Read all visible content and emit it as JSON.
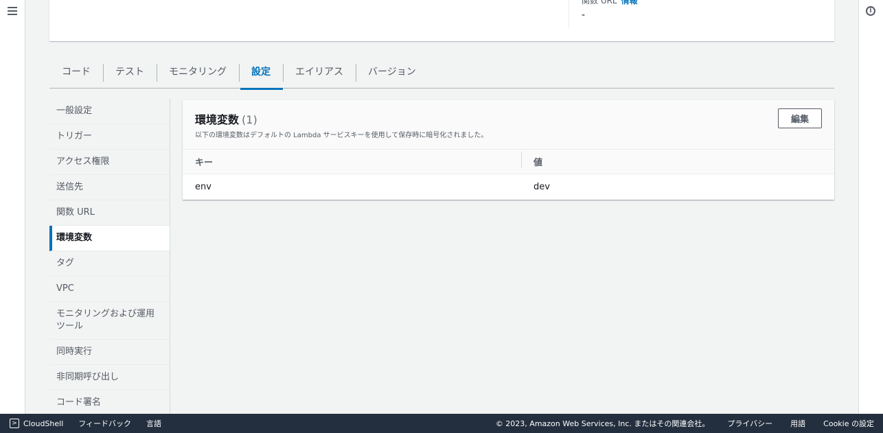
{
  "top": {
    "func_url_label": "関数 URL",
    "func_url_info": "情報",
    "func_url_value": "-"
  },
  "tabs": [
    {
      "label": "コード"
    },
    {
      "label": "テスト"
    },
    {
      "label": "モニタリング"
    },
    {
      "label": "設定",
      "active": true
    },
    {
      "label": "エイリアス"
    },
    {
      "label": "バージョン"
    }
  ],
  "sidenav": [
    {
      "label": "一般設定"
    },
    {
      "label": "トリガー"
    },
    {
      "label": "アクセス権限"
    },
    {
      "label": "送信先"
    },
    {
      "label": "関数 URL"
    },
    {
      "label": "環境変数",
      "active": true
    },
    {
      "label": "タグ"
    },
    {
      "label": "VPC"
    },
    {
      "label": "モニタリングおよび運用ツール"
    },
    {
      "label": "同時実行"
    },
    {
      "label": "非同期呼び出し"
    },
    {
      "label": "コード署名"
    }
  ],
  "env": {
    "title": "環境変数",
    "count": "(1)",
    "description": "以下の環境変数はデフォルトの Lambda サービスキーを使用して保存時に暗号化されました。",
    "edit_label": "編集",
    "columns": {
      "key": "キー",
      "value": "値"
    },
    "rows": [
      {
        "key": "env",
        "value": "dev"
      }
    ]
  },
  "footer": {
    "cloudshell": "CloudShell",
    "feedback": "フィードバック",
    "language": "言語",
    "copyright": "© 2023, Amazon Web Services, Inc. またはその関連会社。",
    "privacy": "プライバシー",
    "terms": "用語",
    "cookie": "Cookie の設定"
  },
  "colors": {
    "accent": "#0073bb",
    "footer_bg": "#232f3e",
    "page_bg": "#f2f3f3"
  }
}
